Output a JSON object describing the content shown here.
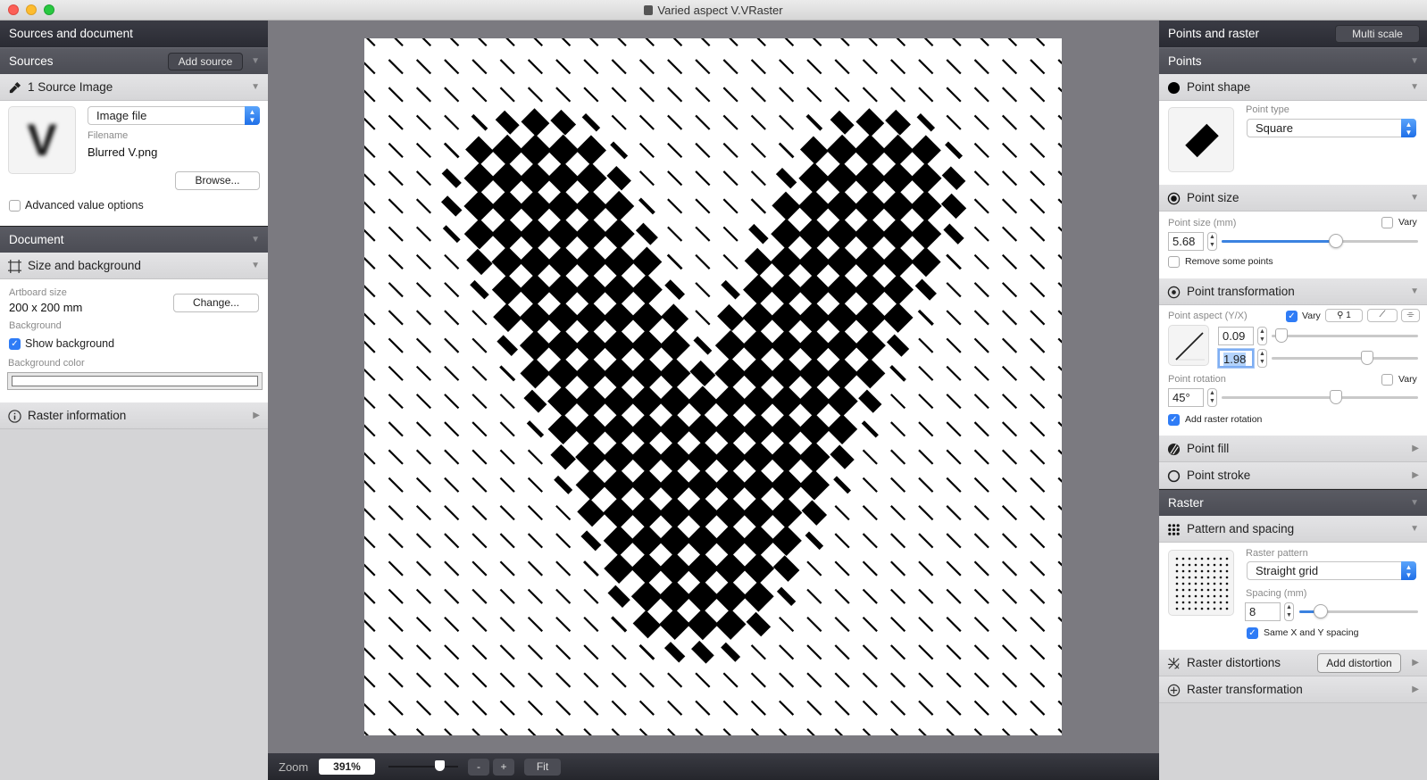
{
  "window": {
    "title": "Varied aspect V.VRaster"
  },
  "left": {
    "header": "Sources and document",
    "sources": {
      "label": "Sources",
      "add_button": "Add source"
    },
    "source_image": {
      "label": "1 Source Image",
      "type_select": "Image file",
      "filename_label": "Filename",
      "filename": "Blurred V.png",
      "browse_button": "Browse...",
      "advanced_label": "Advanced value options",
      "advanced_checked": false,
      "thumb_letter": "V"
    },
    "document": {
      "label": "Document"
    },
    "size_bg": {
      "label": "Size and background",
      "artboard_label": "Artboard size",
      "artboard_value": "200 x 200 mm",
      "change_button": "Change...",
      "background_label": "Background",
      "show_bg_label": "Show background",
      "show_bg_checked": true,
      "bg_color_label": "Background color",
      "bg_color": "#ffffff"
    },
    "raster_info": {
      "label": "Raster information"
    }
  },
  "right": {
    "header": "Points and raster",
    "multi_scale_button": "Multi scale",
    "points": {
      "label": "Points"
    },
    "point_shape": {
      "label": "Point shape",
      "type_label": "Point type",
      "type_value": "Square"
    },
    "point_size": {
      "label": "Point size",
      "size_label": "Point size (mm)",
      "size_value": "5.68",
      "slider_percent": 58,
      "vary_label": "Vary",
      "vary_checked": false,
      "remove_label": "Remove some points",
      "remove_checked": false
    },
    "point_transform": {
      "label": "Point transformation",
      "aspect_label": "Point aspect (Y/X)",
      "vary_label": "Vary",
      "vary_checked": true,
      "source_button": "1",
      "aspect_min": "0.09",
      "aspect_max": "1.98",
      "aspect_min_percent": 7,
      "aspect_max_percent": 65,
      "rotation_label": "Point rotation",
      "rotation_value": "45°",
      "rotation_percent": 58,
      "rotation_vary_label": "Vary",
      "rotation_vary_checked": false,
      "add_raster_rotation_label": "Add raster rotation",
      "add_raster_rotation_checked": true
    },
    "point_fill": {
      "label": "Point fill"
    },
    "point_stroke": {
      "label": "Point stroke"
    },
    "raster": {
      "label": "Raster"
    },
    "pattern": {
      "label": "Pattern and spacing",
      "pattern_label": "Raster pattern",
      "pattern_value": "Straight grid",
      "spacing_label": "Spacing (mm)",
      "spacing_value": "8",
      "spacing_percent": 18,
      "same_xy_label": "Same X and Y spacing",
      "same_xy_checked": true
    },
    "distortions": {
      "label": "Raster distortions",
      "add_button": "Add distortion"
    },
    "raster_transform": {
      "label": "Raster transformation"
    }
  },
  "bottom": {
    "zoom_label": "Zoom",
    "zoom_value": "391%",
    "zoom_minus": "-",
    "zoom_plus": "+",
    "fit_button": "Fit"
  },
  "artwork": {
    "grid_columns": 25,
    "grid_rows": 25,
    "point_rotation_deg": 45,
    "aspect_range": [
      0.09,
      1.98
    ],
    "colors": {
      "point": "#000000",
      "background": "#ffffff",
      "accent": "#2f7cf6"
    }
  }
}
